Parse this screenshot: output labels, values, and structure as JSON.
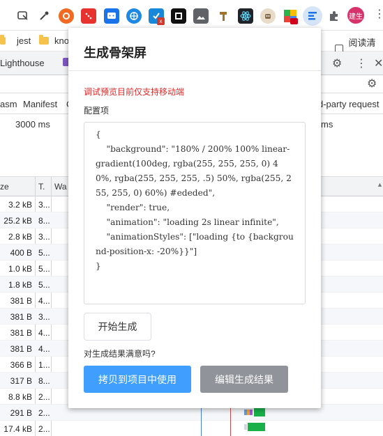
{
  "bookmarks": {
    "items": [
      {
        "label": "jest"
      },
      {
        "label": "kno"
      },
      {
        "label": "阅读清单"
      }
    ]
  },
  "profile": {
    "label": "建生"
  },
  "devtools": {
    "tabs": [
      "Lighthouse"
    ],
    "filter": {
      "left1": "asm",
      "left2": "Manifest",
      "left3": "C",
      "right": "d-party request"
    },
    "overview": {
      "left": "3000 ms",
      "right": "ms"
    },
    "header": {
      "col1": "ze",
      "col2": "T.",
      "col3": "Wa"
    },
    "rows": [
      {
        "size": "3.2 kB",
        "time": "3..."
      },
      {
        "size": "25.2 kB",
        "time": "8..."
      },
      {
        "size": "2.8 kB",
        "time": "3..."
      },
      {
        "size": "400 B",
        "time": "5..."
      },
      {
        "size": "1.0 kB",
        "time": "5..."
      },
      {
        "size": "1.8 kB",
        "time": "5..."
      },
      {
        "size": "381 B",
        "time": "4..."
      },
      {
        "size": "381 B",
        "time": "3..."
      },
      {
        "size": "381 B",
        "time": "4..."
      },
      {
        "size": "381 B",
        "time": "4..."
      },
      {
        "size": "366 B",
        "time": "1..."
      },
      {
        "size": "317 B",
        "time": "8..."
      },
      {
        "size": "8.8 kB",
        "time": "2..."
      },
      {
        "size": "291 B",
        "time": "2..."
      },
      {
        "size": "17.4 kB",
        "time": "2..."
      }
    ]
  },
  "popup": {
    "title": "生成骨架屏",
    "warning": "调试预览目前仅支持移动端",
    "config_label": "配置项",
    "config_text": "{\n    \"background\": \"180% / 200% 100% linear-gradient(100deg, rgba(255, 255, 255, 0) 40%, rgba(255, 255, 255, .5) 50%, rgba(255, 255, 255, 0) 60%) #ededed\",\n    \"render\": true,\n    \"animation\": \"loading 2s linear infinite\",\n    \"animationStyles\": [\"loading {to {background-position-x: -20%}}\"]\n}",
    "generate_button": "开始生成",
    "satisfied_text": "对生成结果满意吗?",
    "copy_button": "拷贝到项目中使用",
    "edit_button": "编辑生成结果"
  },
  "colors": {
    "primary": "#409eff",
    "secondary": "#909399",
    "warning": "#e02a2a"
  }
}
